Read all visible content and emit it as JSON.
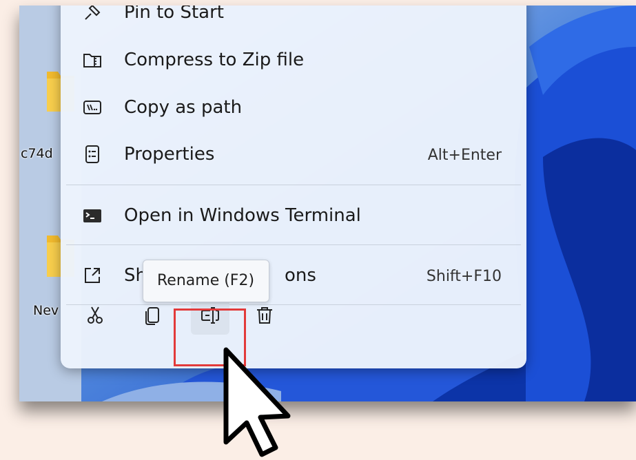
{
  "desktop": {
    "icons": [
      {
        "label": "c74d"
      },
      {
        "label": "Nev"
      }
    ]
  },
  "context_menu": {
    "items": [
      {
        "label": "Pin to Start",
        "icon": "pin-icon",
        "shortcut": ""
      },
      {
        "label": "Compress to Zip file",
        "icon": "zip-folder-icon",
        "shortcut": ""
      },
      {
        "label": "Copy as path",
        "icon": "copy-path-icon",
        "shortcut": ""
      },
      {
        "label": "Properties",
        "icon": "properties-icon",
        "shortcut": "Alt+Enter"
      },
      {
        "label": "Open in Windows Terminal",
        "icon": "terminal-icon",
        "shortcut": ""
      },
      {
        "label": "Sh",
        "label_tail": "ons",
        "icon": "show-more-options-icon",
        "shortcut": "Shift+F10"
      }
    ],
    "toolbar": [
      {
        "name": "cut",
        "icon": "scissors-icon"
      },
      {
        "name": "copy",
        "icon": "copy-icon"
      },
      {
        "name": "rename",
        "icon": "rename-icon"
      },
      {
        "name": "delete",
        "icon": "trash-icon"
      }
    ]
  },
  "tooltip": {
    "text": "Rename (F2)"
  },
  "colors": {
    "highlight": "#e23a3a",
    "menu_background": "#ecf3fc",
    "wallpaper_blue": "#1f56d8"
  }
}
